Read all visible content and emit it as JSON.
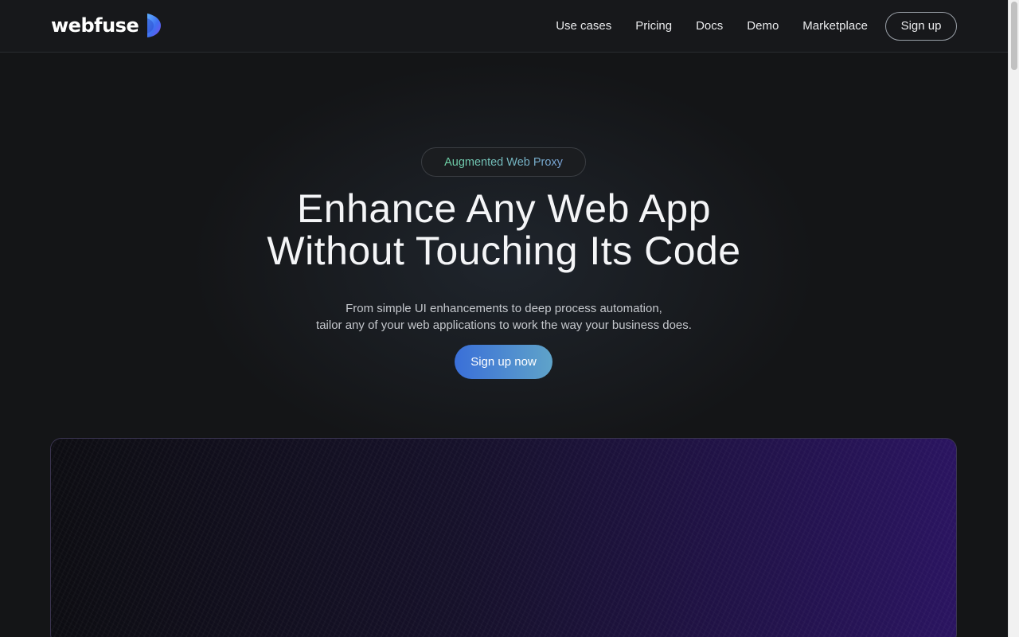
{
  "brand": {
    "name": "webfuse",
    "accent": "#3a6fd8"
  },
  "nav": {
    "items": [
      {
        "label": "Use cases"
      },
      {
        "label": "Pricing"
      },
      {
        "label": "Docs"
      },
      {
        "label": "Demo"
      },
      {
        "label": "Marketplace"
      }
    ],
    "signup_label": "Sign up"
  },
  "hero": {
    "badge": "Augmented Web Proxy",
    "title_line1": "Enhance Any Web App",
    "title_line2": "Without Touching Its Code",
    "subtitle_line1": "From simple UI enhancements to deep process automation,",
    "subtitle_line2": "tailor any of your web applications to work the way your business does.",
    "cta_label": "Sign up now"
  }
}
